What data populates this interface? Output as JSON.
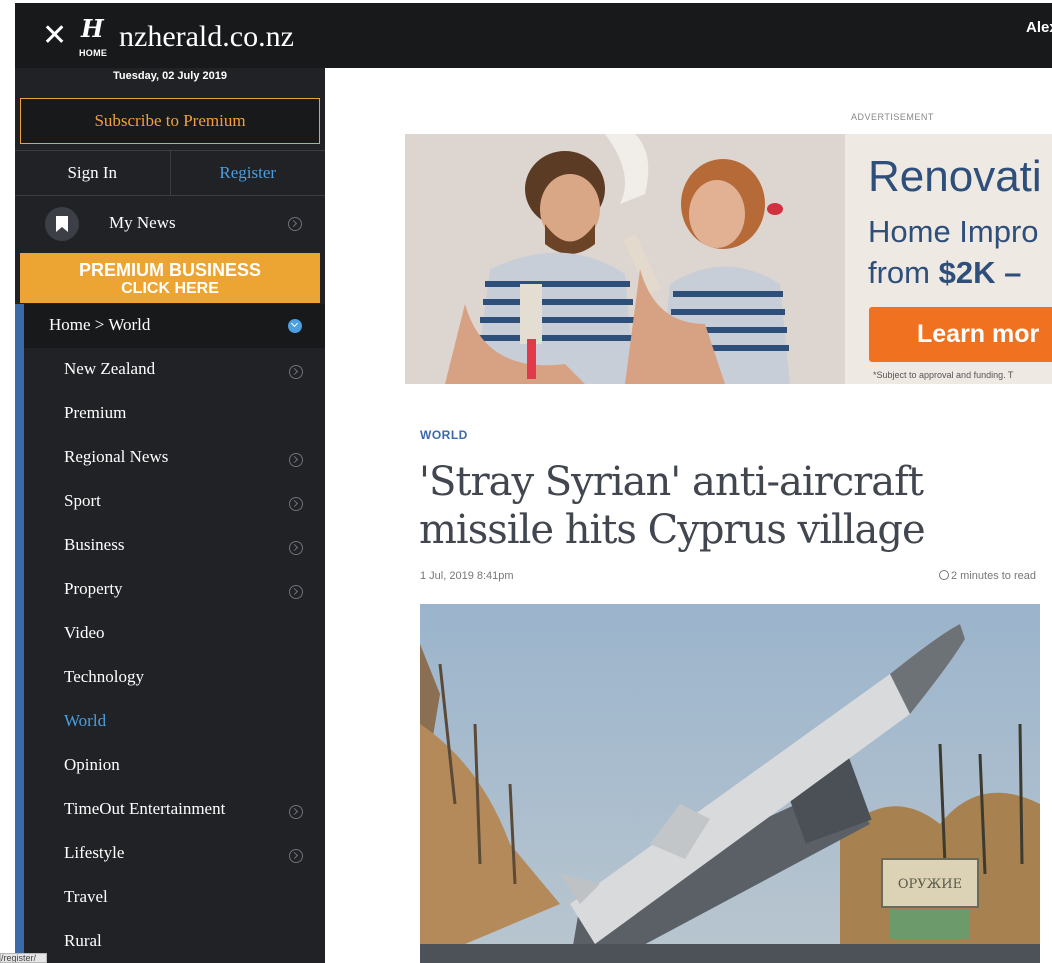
{
  "header": {
    "close_icon": "close-icon",
    "logo_mark": "H",
    "home_label": "HOME",
    "site_name": "nzherald.co.nz",
    "user_name": "Alexa"
  },
  "sidebar": {
    "date": "Tuesday, 02 July 2019",
    "subscribe_label": "Subscribe to Premium",
    "signin_label": "Sign In",
    "register_label": "Register",
    "mynews_label": "My News",
    "premium_line1": "PREMIUM BUSINESS",
    "premium_line2": "CLICK HERE",
    "breadcrumb": "Home > World",
    "items": [
      {
        "label": "New Zealand",
        "chevron": true
      },
      {
        "label": "Premium",
        "chevron": false
      },
      {
        "label": "Regional News",
        "chevron": true
      },
      {
        "label": "Sport",
        "chevron": true
      },
      {
        "label": "Business",
        "chevron": true
      },
      {
        "label": "Property",
        "chevron": true
      },
      {
        "label": "Video",
        "chevron": false
      },
      {
        "label": "Technology",
        "chevron": false
      },
      {
        "label": "World",
        "chevron": false,
        "active": true
      },
      {
        "label": "Opinion",
        "chevron": false
      },
      {
        "label": "TimeOut Entertainment",
        "chevron": true
      },
      {
        "label": "Lifestyle",
        "chevron": true
      },
      {
        "label": "Travel",
        "chevron": false
      },
      {
        "label": "Rural",
        "chevron": false
      }
    ]
  },
  "status_url": "/register/",
  "ad": {
    "label": "ADVERTISEMENT",
    "title": "Renovati",
    "line2": "Home Impro",
    "line3_prefix": "from ",
    "line3_amount": "$2K –",
    "button": "Learn mor",
    "disclaimer": "*Subject to approval and funding. T"
  },
  "article": {
    "category": "WORLD",
    "headline": "'Stray Syrian' anti-aircraft missile hits Cyprus village",
    "date": "1 Jul, 2019 8:41pm",
    "read_time": "2 minutes to read"
  },
  "colors": {
    "topbar": "#17191b",
    "sidebar": "#202226",
    "accent_blue": "#3b6aa8",
    "link_blue": "#4a9fe0",
    "orange": "#eca433",
    "ad_orange": "#f07221",
    "headline": "#41464f"
  }
}
